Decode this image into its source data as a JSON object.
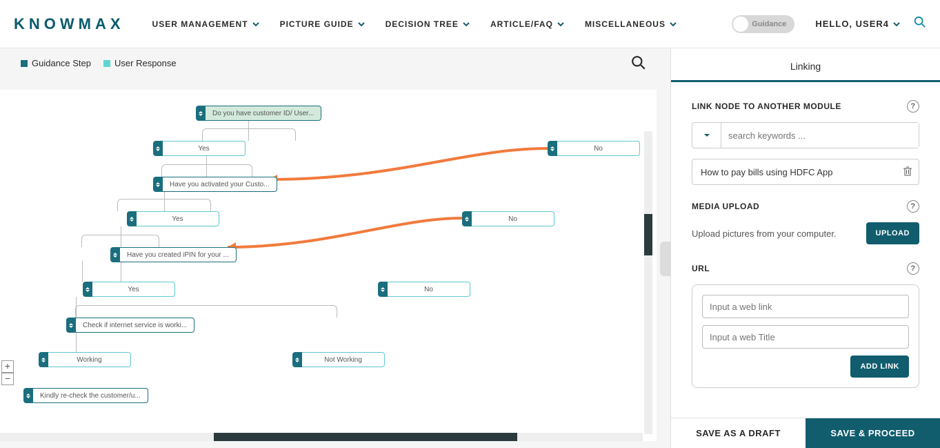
{
  "header": {
    "logo": "KNOWMAX",
    "nav": [
      "USER MANAGEMENT",
      "PICTURE GUIDE",
      "DECISION TREE",
      "ARTICLE/FAQ",
      "MISCELLANEOUS"
    ],
    "toggle_label": "Guidance",
    "user_greeting": "HELLO, USER4"
  },
  "legend": {
    "guidance": "Guidance Step",
    "response": "User Response"
  },
  "nodes": {
    "root": "Do you have customer ID/ User...",
    "yes1": "Yes",
    "no1": "No",
    "activated": "Have you activated your Custo...",
    "yes2": "Yes",
    "no2": "No",
    "ipin": "Have you created iPIN for your ...",
    "yes3": "Yes",
    "no3": "No",
    "internet": "Check if internet service is worki...",
    "working": "Working",
    "notworking": "Not Working",
    "recheck": "Kindly re-check the customer/u..."
  },
  "zoom": {
    "in": "+",
    "out": "−"
  },
  "sidebar": {
    "title": "Linking",
    "link_section": "LINK NODE TO ANOTHER MODULE",
    "search_placeholder": "search keywords ...",
    "linked_item": "How to pay bills using HDFC App",
    "media_section": "MEDIA UPLOAD",
    "media_text": "Upload pictures from your computer.",
    "upload_btn": "UPLOAD",
    "url_section": "URL",
    "url_link_placeholder": "Input a web link",
    "url_title_placeholder": "Input a web Title",
    "add_link_btn": "ADD LINK"
  },
  "footer": {
    "draft": "SAVE AS A DRAFT",
    "proceed": "SAVE & PROCEED"
  }
}
